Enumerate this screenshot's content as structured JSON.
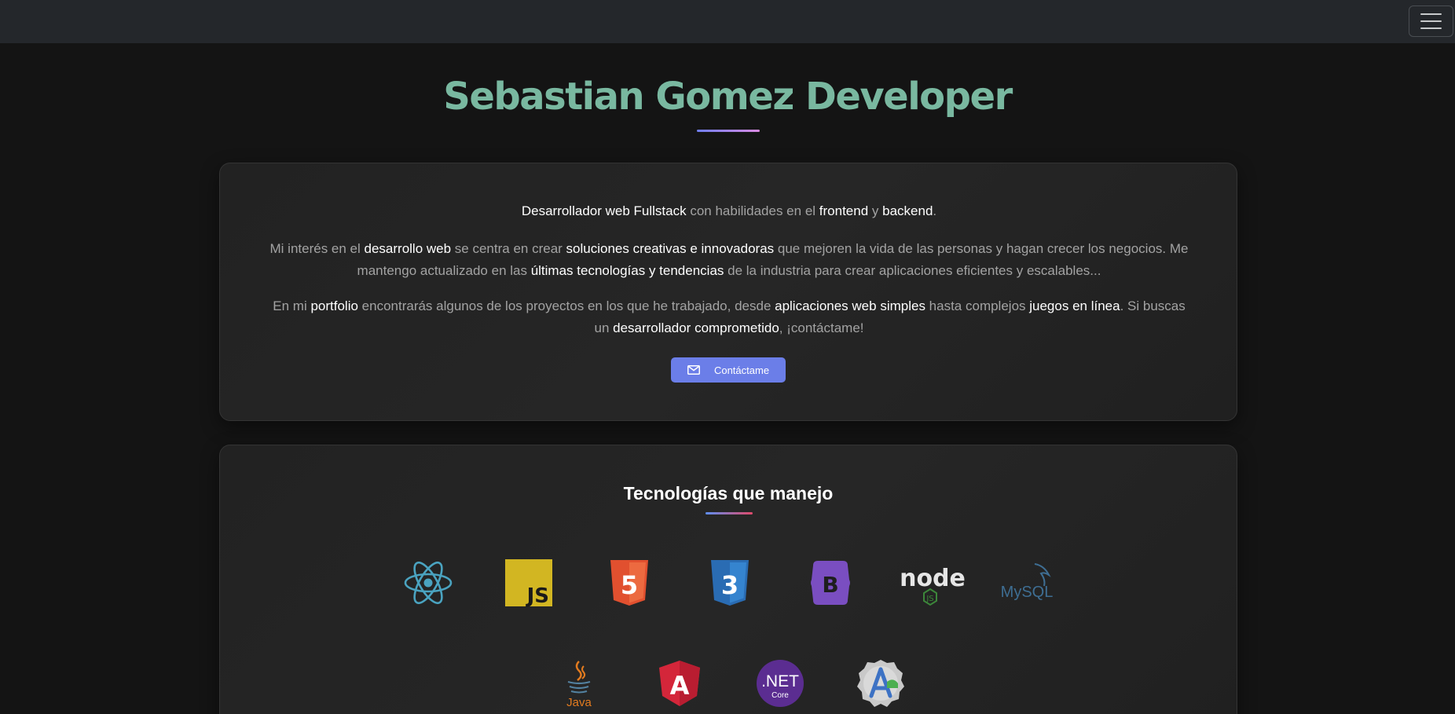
{
  "navbar": {
    "menu_icon": "hamburger-menu-icon"
  },
  "hero": {
    "title": "Sebastian Gomez Developer"
  },
  "about": {
    "p1": [
      {
        "t": "Desarrollador web Fullstack",
        "b": true
      },
      {
        "t": " con habilidades en el ",
        "b": false
      },
      {
        "t": "frontend",
        "b": true
      },
      {
        "t": " y ",
        "b": false
      },
      {
        "t": "backend",
        "b": true
      },
      {
        "t": ".",
        "b": false
      }
    ],
    "p2": [
      {
        "t": "Mi interés en el ",
        "b": false
      },
      {
        "t": "desarrollo web",
        "b": true
      },
      {
        "t": " se centra en crear ",
        "b": false
      },
      {
        "t": "soluciones creativas e innovadoras",
        "b": true
      },
      {
        "t": " que mejoren la vida de las personas y hagan crecer los negocios. Me mantengo actualizado en las ",
        "b": false
      },
      {
        "t": "últimas tecnologías y tendencias",
        "b": true
      },
      {
        "t": " de la industria para crear aplicaciones eficientes y escalables...",
        "b": false
      }
    ],
    "p3": [
      {
        "t": "En mi ",
        "b": false
      },
      {
        "t": "portfolio",
        "b": true
      },
      {
        "t": " encontrarás algunos de los proyectos en los que he trabajado, desde ",
        "b": false
      },
      {
        "t": "aplicaciones web simples",
        "b": true
      },
      {
        "t": " hasta complejos ",
        "b": false
      },
      {
        "t": "juegos en línea",
        "b": true
      },
      {
        "t": ". Si buscas un ",
        "b": false
      },
      {
        "t": "desarrollador comprometido",
        "b": true
      },
      {
        "t": ", ¡contáctame!",
        "b": false
      }
    ],
    "contact_button": {
      "label": "Contáctame",
      "icon": "envelope-icon"
    }
  },
  "tech": {
    "title": "Tecnologías que manejo",
    "icons": [
      {
        "name": "react-icon",
        "color": "#4aa3c0"
      },
      {
        "name": "javascript-icon",
        "color": "#d2b622",
        "text": "JS"
      },
      {
        "name": "html5-icon",
        "color": "#e1502f",
        "text": "5"
      },
      {
        "name": "css3-icon",
        "color": "#2a6cb3",
        "text": "3"
      },
      {
        "name": "bootstrap-icon",
        "color": "#7a4ec1",
        "text": "B"
      },
      {
        "name": "nodejs-icon",
        "color": "#e6e6e6",
        "text": "node",
        "sub": "JS"
      },
      {
        "name": "mysql-icon",
        "color": "#3e6e93",
        "text": "MySQL"
      },
      {
        "name": "java-icon",
        "color": "#e37b1f",
        "text": "Java"
      },
      {
        "name": "angular-icon",
        "color": "#d4263a",
        "text": "A"
      },
      {
        "name": "dotnet-core-icon",
        "color": "#5b2d91",
        "text": ".NET",
        "sub": "Core"
      },
      {
        "name": "android-studio-icon",
        "color": "#c9c9c9"
      }
    ]
  }
}
